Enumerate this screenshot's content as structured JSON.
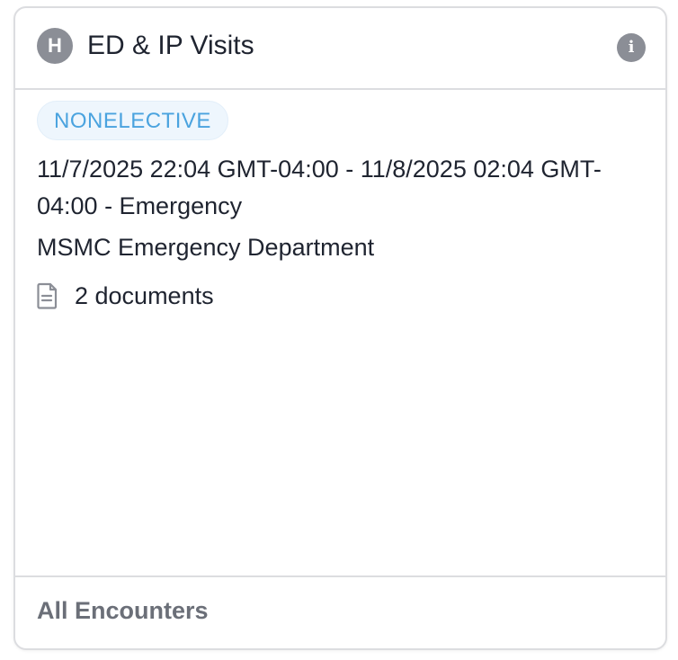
{
  "card": {
    "badge_letter": "H",
    "title": "ED & IP Visits",
    "info_icon": "info-icon",
    "info_glyph": "i"
  },
  "visit": {
    "type_tag": "NONELECTIVE",
    "title": "11/7/2025 22:04 GMT-04:00 - 11/8/2025 02:04 GMT-04:00 - Emergency",
    "location": "MSMC Emergency Department",
    "documents_icon": "document-icon",
    "documents_label": "2 documents"
  },
  "footer": {
    "link_label": "All Encounters"
  },
  "colors": {
    "badge_gray": "#8b8e96",
    "pill_bg": "#eef6fd",
    "pill_text": "#4aa3df",
    "text_primary": "#1f2430",
    "footer_text": "#6b6f78",
    "border": "#dcdde0"
  }
}
